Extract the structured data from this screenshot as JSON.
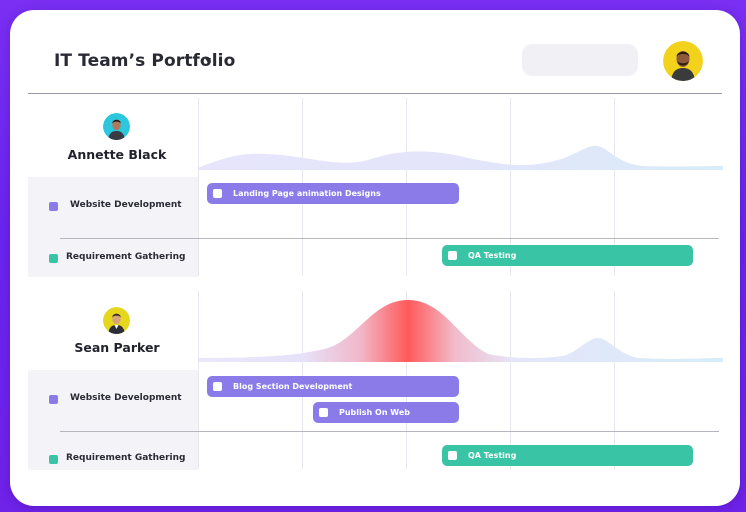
{
  "header": {
    "portfolio_title": "IT Team’s Portfolio",
    "dropdown_icon": "caret-down-icon"
  },
  "colors": {
    "background": "#6f22e8",
    "accent_purple": "#8a7be9",
    "accent_teal": "#3ac4a6",
    "heat_peak": "#ff5a5a"
  },
  "people": [
    {
      "name": "Annette Black",
      "projects": [
        {
          "label": "Website Development",
          "color": "#8a7be9",
          "tasks": [
            {
              "label": "Landing Page animation Designs"
            }
          ]
        },
        {
          "label": "Requirement Gathering",
          "color": "#3ac4a6",
          "tasks": [
            {
              "label": "QA Testing"
            }
          ]
        }
      ]
    },
    {
      "name": "Sean Parker",
      "projects": [
        {
          "label": "Website Development",
          "color": "#8a7be9",
          "tasks": [
            {
              "label": "Blog Section Development"
            },
            {
              "label": "Publish On Web"
            }
          ]
        },
        {
          "label": "Requirement Gathering",
          "color": "#3ac4a6",
          "tasks": [
            {
              "label": "QA Testing"
            }
          ]
        }
      ]
    }
  ]
}
